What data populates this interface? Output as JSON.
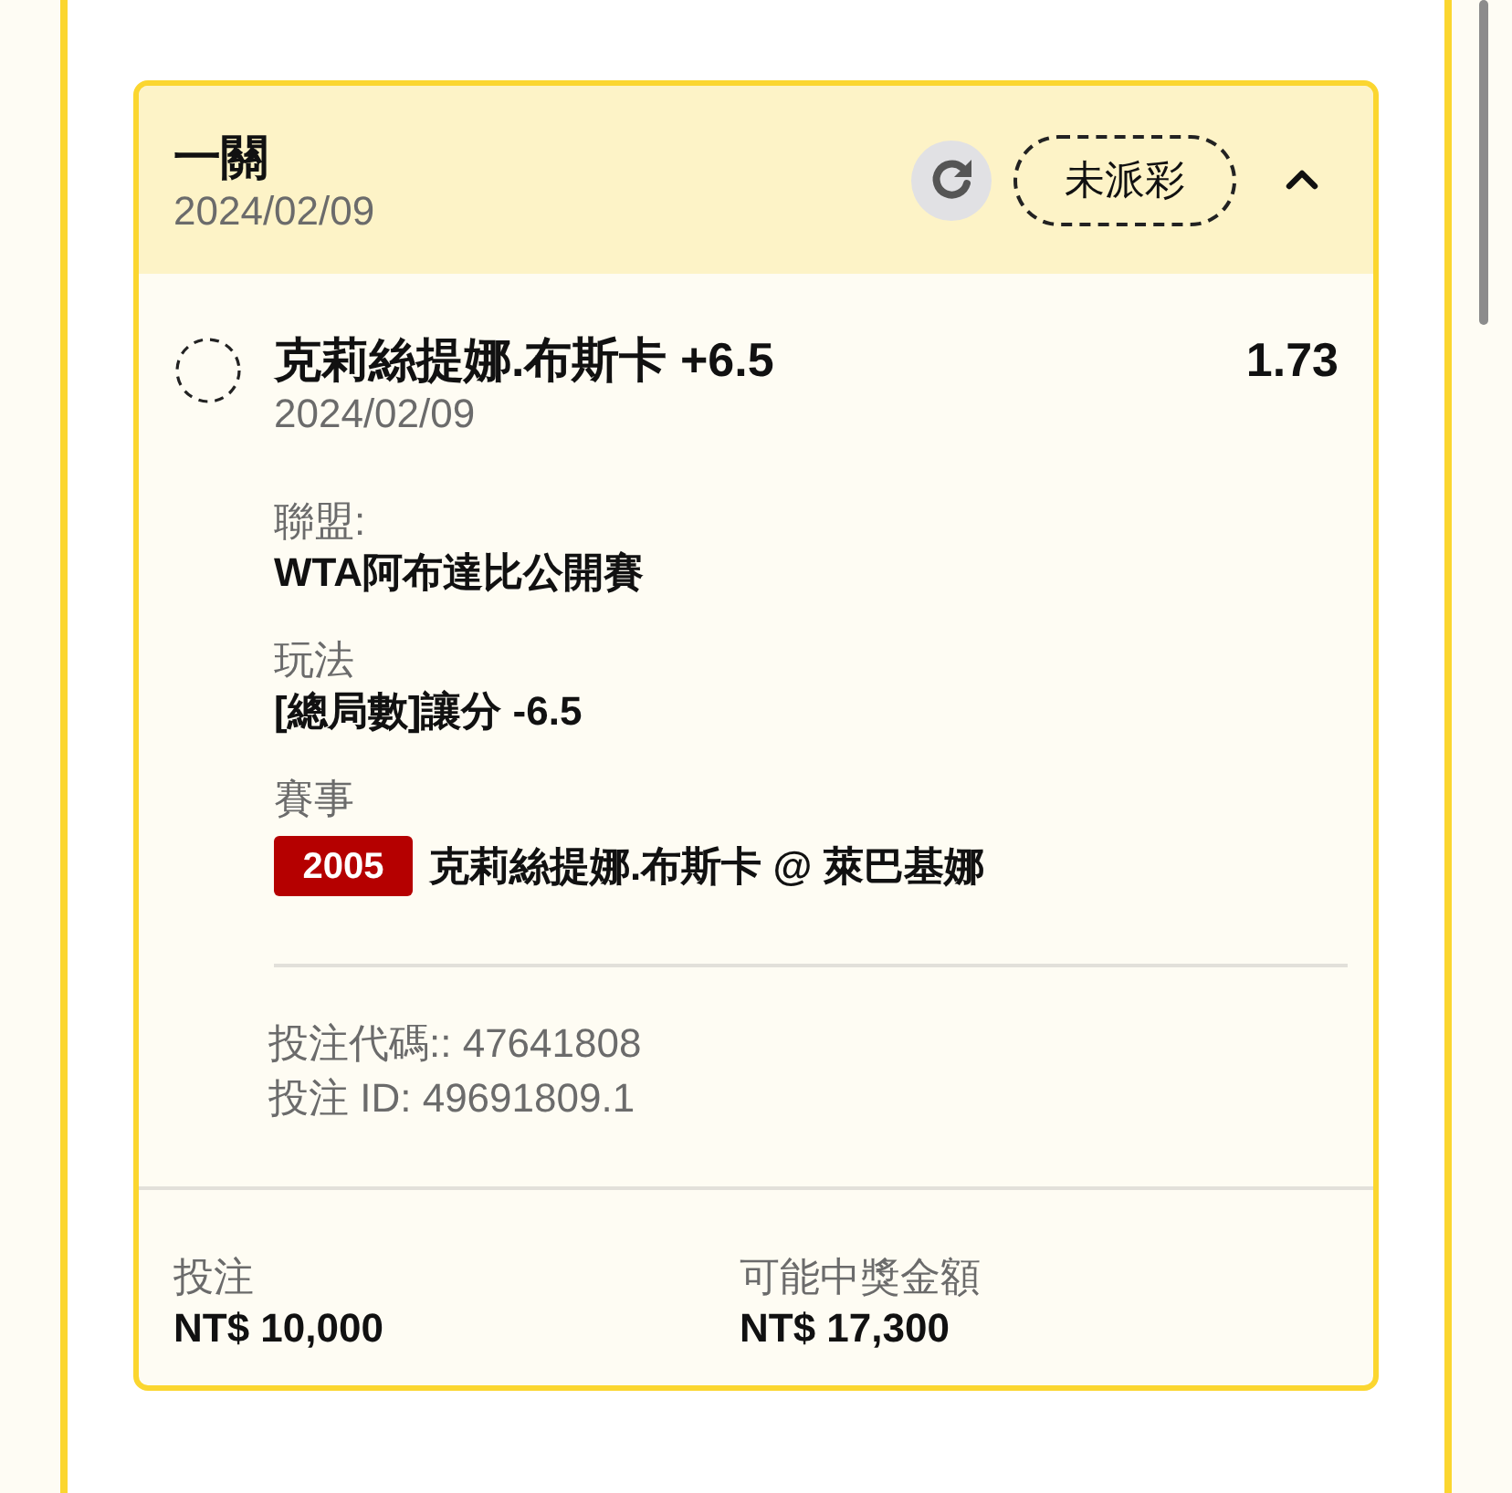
{
  "bet_card": {
    "title": "一關",
    "date": "2024/02/09",
    "status_badge": "未派彩",
    "expanded": true,
    "selection": {
      "name": "克莉絲提娜.布斯卡 +6.5",
      "odds": "1.73",
      "date": "2024/02/09",
      "details": [
        {
          "kind": "text",
          "label": "聯盟:",
          "value": "WTA阿布達比公開賽"
        },
        {
          "kind": "text",
          "label": "玩法",
          "value": "[總局數]讓分 -6.5"
        },
        {
          "kind": "event",
          "label": "賽事",
          "event_code": "2005",
          "value": "克莉絲提娜.布斯卡 @ 萊巴基娜"
        }
      ],
      "bet_codes": [
        "投注代碼:: 47641808",
        "投注 ID: 49691809.1"
      ]
    },
    "footer": [
      {
        "label": "投注",
        "value": "NT$ 10,000"
      },
      {
        "label": "可能中獎金額",
        "value": "NT$ 17,300"
      }
    ]
  }
}
